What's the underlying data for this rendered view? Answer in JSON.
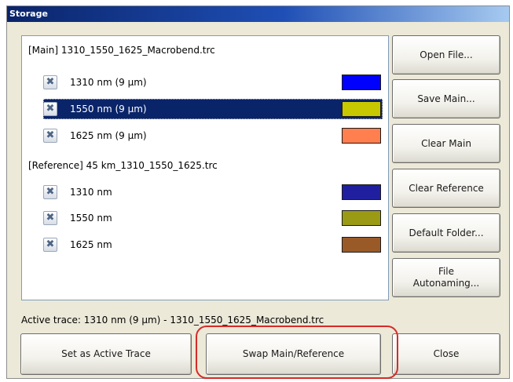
{
  "window": {
    "title": "Storage"
  },
  "list": {
    "main_header": "[Main] 1310_1550_1625_Macrobend.trc",
    "main_traces": [
      {
        "label": "1310 nm (9 µm)",
        "color": "#0000ff",
        "checked": true,
        "selected": false
      },
      {
        "label": "1550 nm (9 µm)",
        "color": "#c8c800",
        "checked": true,
        "selected": true
      },
      {
        "label": "1625 nm (9 µm)",
        "color": "#ff7f4f",
        "checked": true,
        "selected": false
      }
    ],
    "reference_header": "[Reference] 45 km_1310_1550_1625.trc",
    "reference_traces": [
      {
        "label": "1310 nm",
        "color": "#1f1f9f",
        "checked": true,
        "selected": false
      },
      {
        "label": "1550 nm",
        "color": "#9a9a14",
        "checked": true,
        "selected": false
      },
      {
        "label": "1625 nm",
        "color": "#9a5a28",
        "checked": true,
        "selected": false
      }
    ]
  },
  "side_buttons": {
    "open_file": "Open File...",
    "save_main": "Save Main...",
    "clear_main": "Clear Main",
    "clear_reference": "Clear Reference",
    "default_folder": "Default Folder...",
    "file_autonaming": "File\nAutonaming..."
  },
  "status": {
    "active_trace": "Active trace: 1310 nm (9 µm) - 1310_1550_1625_Macrobend.trc"
  },
  "bottom_buttons": {
    "set_active": "Set as Active Trace",
    "swap": "Swap Main/Reference",
    "close": "Close"
  },
  "icons": {
    "checkbox_mark": "x-mark-icon"
  }
}
